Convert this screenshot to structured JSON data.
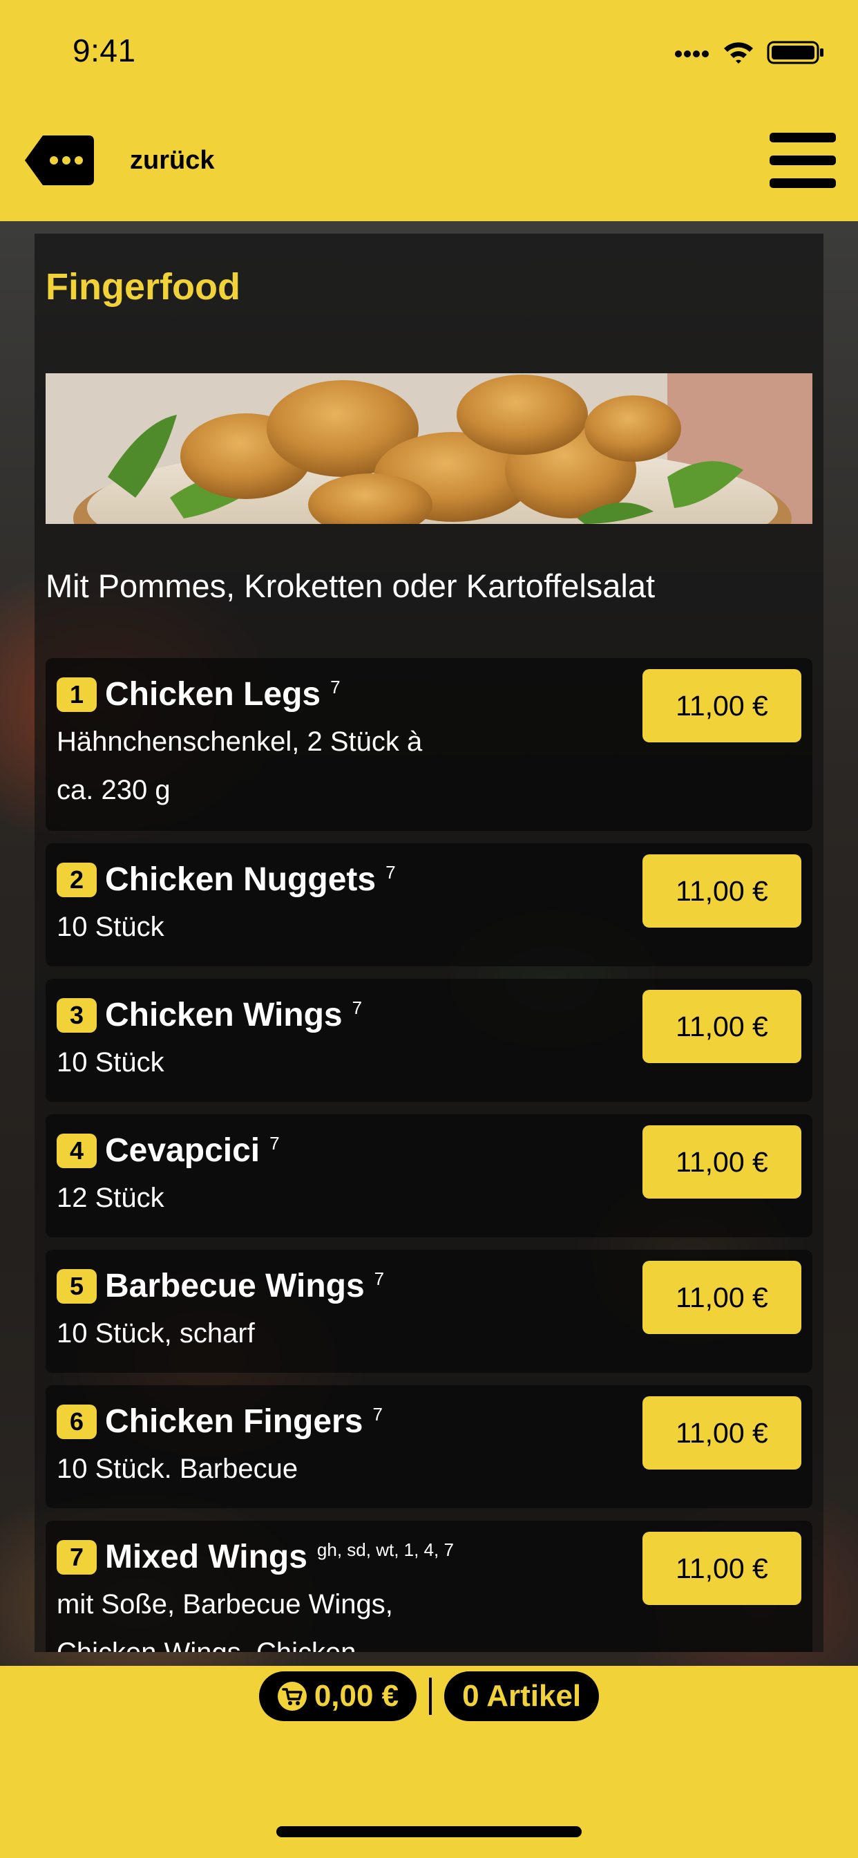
{
  "status_bar": {
    "time": "9:41"
  },
  "header": {
    "back_label": "zurück",
    "back_icon": "ellipsis-tag-icon",
    "menu_icon": "hamburger-menu-icon"
  },
  "section": {
    "title": "Fingerfood",
    "subtitle": "Mit Pommes, Kroketten oder Kartoffelsalat",
    "hero_image": "chicken-nuggets-photo"
  },
  "items": [
    {
      "number": "1",
      "name": "Chicken Legs",
      "allergens": "7",
      "desc_lines": [
        "Hähnchenschenkel, 2 Stück à",
        "ca. 230 g"
      ],
      "price": "11,00 €"
    },
    {
      "number": "2",
      "name": "Chicken Nuggets",
      "allergens": "7",
      "desc_lines": [
        "10 Stück"
      ],
      "price": "11,00 €"
    },
    {
      "number": "3",
      "name": "Chicken Wings",
      "allergens": "7",
      "desc_lines": [
        "10 Stück"
      ],
      "price": "11,00 €"
    },
    {
      "number": "4",
      "name": "Cevapcici",
      "allergens": "7",
      "desc_lines": [
        "12 Stück"
      ],
      "price": "11,00 €"
    },
    {
      "number": "5",
      "name": "Barbecue Wings",
      "allergens": "7",
      "desc_lines": [
        "10 Stück, scharf"
      ],
      "price": "11,00 €"
    },
    {
      "number": "6",
      "name": "Chicken Fingers",
      "allergens": "7",
      "desc_lines": [
        "10 Stück. Barbecue"
      ],
      "price": "11,00 €"
    },
    {
      "number": "7",
      "name": "Mixed Wings",
      "allergens": "gh, sd, wt, 1, 4, 7",
      "desc_lines": [
        "mit Soße, Barbecue Wings,",
        "Chicken Wings, Chicken"
      ],
      "price": "11,00 €"
    }
  ],
  "cart": {
    "total": "0,00 €",
    "count": "0 Artikel",
    "cart_icon": "cart-icon"
  },
  "colors": {
    "accent": "#f1d339",
    "panel": "#141414",
    "text_on_dark": "#ffffff"
  }
}
